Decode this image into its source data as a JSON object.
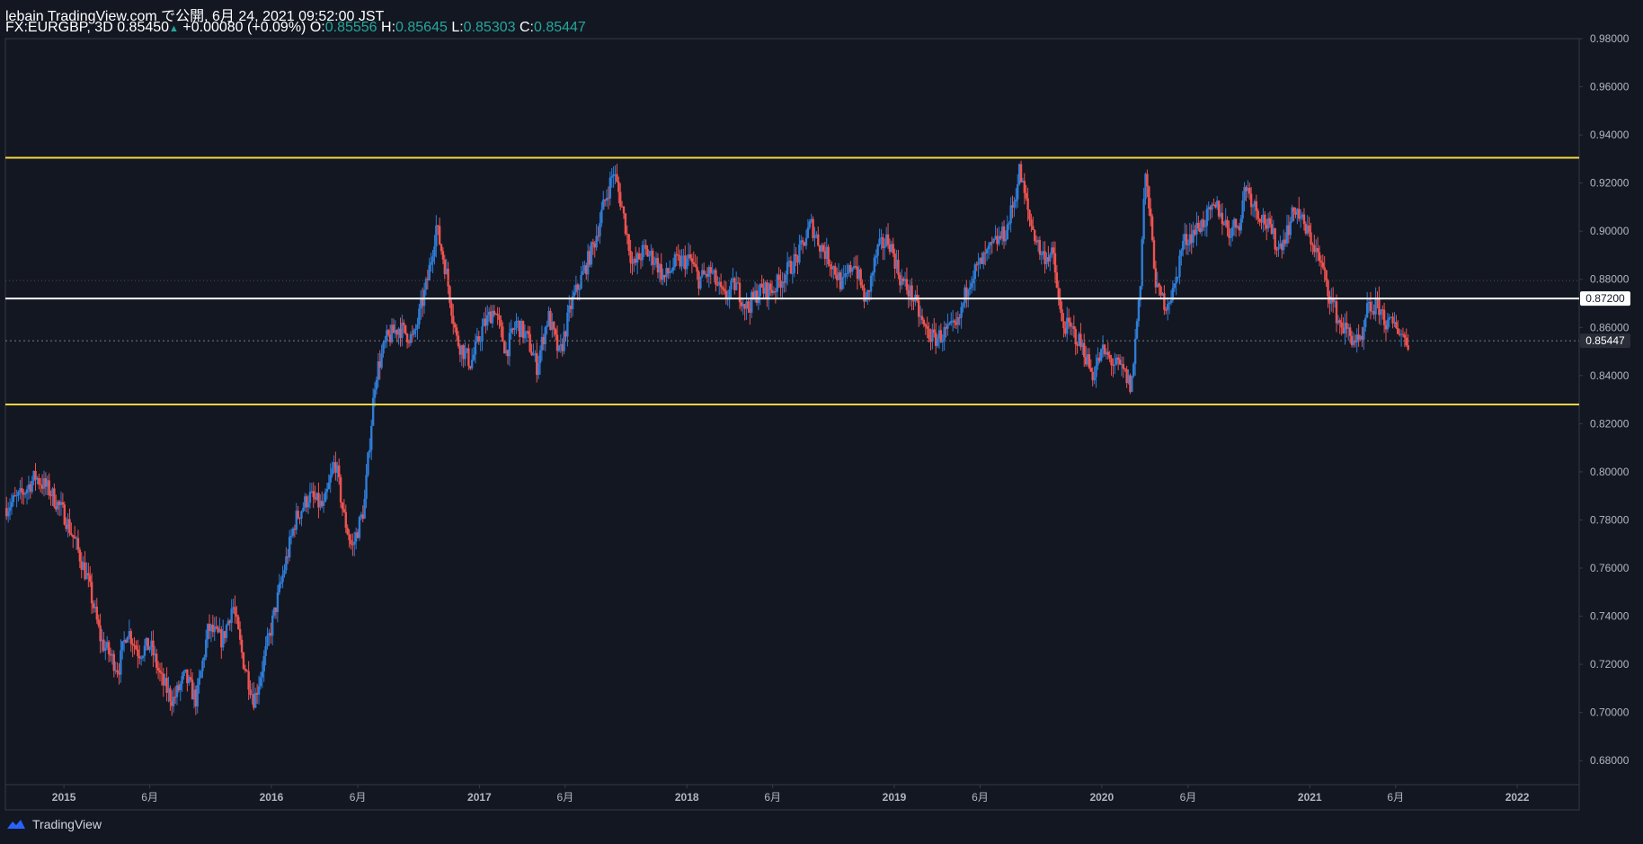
{
  "header": {
    "line1": "lebain TradingView.com で公開, 6月 24, 2021 09:52:00 JST",
    "symbol": "FX:EURGBP, 3D",
    "last": "0.85450",
    "arrow": "▲",
    "change": "+0.00080 (+0.09%)",
    "o_label": "O:",
    "o_value": "0.85556",
    "h_label": "H:",
    "h_value": "0.85645",
    "l_label": "L:",
    "l_value": "0.85303",
    "c_label": "C:",
    "c_value": "0.85447"
  },
  "footer": {
    "brand": "TradingView"
  },
  "colors": {
    "background": "#131722",
    "up": "#2e7dd7",
    "down": "#ef5350",
    "support_resistance": "#f5d547",
    "level_line": "#ffffff",
    "axis_text": "#b2b5be"
  },
  "chart_data": {
    "type": "candlestick",
    "title": "FX:EURGBP, 3D",
    "x_tick_labels": [
      "2015",
      "6月",
      "2016",
      "6月",
      "2017",
      "6月",
      "2018",
      "6月",
      "2019",
      "6月",
      "2020",
      "6月",
      "2021",
      "6月",
      "2022"
    ],
    "x_tick_dates": [
      "2015-01-01",
      "2015-06-01",
      "2016-01-01",
      "2016-06-01",
      "2017-01-01",
      "2017-06-01",
      "2018-01-01",
      "2018-06-01",
      "2019-01-01",
      "2019-06-01",
      "2020-01-01",
      "2020-06-01",
      "2021-01-01",
      "2021-06-01",
      "2022-01-01"
    ],
    "xlim": [
      "2014-09-20",
      "2022-04-20"
    ],
    "ylim": [
      0.67,
      0.98
    ],
    "y_tick_labels": [
      "0.98000",
      "0.96000",
      "0.94000",
      "0.92000",
      "0.90000",
      "0.88000",
      "0.86000",
      "0.84000",
      "0.82000",
      "0.80000",
      "0.78000",
      "0.76000",
      "0.74000",
      "0.72000",
      "0.70000",
      "0.68000"
    ],
    "y_ticks": [
      0.98,
      0.96,
      0.94,
      0.92,
      0.9,
      0.88,
      0.86,
      0.84,
      0.82,
      0.8,
      0.78,
      0.76,
      0.74,
      0.72,
      0.7,
      0.68
    ],
    "price_path": [
      [
        "2014-09-22",
        0.785
      ],
      [
        "2014-10-20",
        0.79
      ],
      [
        "2014-11-15",
        0.798
      ],
      [
        "2014-12-10",
        0.792
      ],
      [
        "2015-01-05",
        0.782
      ],
      [
        "2015-01-25",
        0.77
      ],
      [
        "2015-02-15",
        0.755
      ],
      [
        "2015-03-10",
        0.73
      ],
      [
        "2015-04-10",
        0.718
      ],
      [
        "2015-04-25",
        0.735
      ],
      [
        "2015-05-15",
        0.725
      ],
      [
        "2015-06-05",
        0.728
      ],
      [
        "2015-06-25",
        0.713
      ],
      [
        "2015-07-15",
        0.705
      ],
      [
        "2015-08-05",
        0.715
      ],
      [
        "2015-08-25",
        0.705
      ],
      [
        "2015-09-15",
        0.735
      ],
      [
        "2015-10-10",
        0.73
      ],
      [
        "2015-10-28",
        0.745
      ],
      [
        "2015-11-15",
        0.722
      ],
      [
        "2015-12-05",
        0.705
      ],
      [
        "2015-12-25",
        0.725
      ],
      [
        "2016-01-25",
        0.758
      ],
      [
        "2016-02-15",
        0.78
      ],
      [
        "2016-03-10",
        0.79
      ],
      [
        "2016-04-05",
        0.785
      ],
      [
        "2016-04-25",
        0.805
      ],
      [
        "2016-05-10",
        0.782
      ],
      [
        "2016-05-25",
        0.768
      ],
      [
        "2016-06-15",
        0.785
      ],
      [
        "2016-06-24",
        0.81
      ],
      [
        "2016-07-05",
        0.84
      ],
      [
        "2016-07-25",
        0.855
      ],
      [
        "2016-08-15",
        0.86
      ],
      [
        "2016-09-10",
        0.855
      ],
      [
        "2016-10-05",
        0.88
      ],
      [
        "2016-10-20",
        0.902
      ],
      [
        "2016-11-05",
        0.885
      ],
      [
        "2016-11-25",
        0.855
      ],
      [
        "2016-12-20",
        0.845
      ],
      [
        "2017-01-10",
        0.86
      ],
      [
        "2017-01-30",
        0.868
      ],
      [
        "2017-02-20",
        0.85
      ],
      [
        "2017-03-10",
        0.862
      ],
      [
        "2017-03-30",
        0.855
      ],
      [
        "2017-04-15",
        0.844
      ],
      [
        "2017-05-05",
        0.865
      ],
      [
        "2017-05-25",
        0.848
      ],
      [
        "2017-06-15",
        0.87
      ],
      [
        "2017-07-05",
        0.882
      ],
      [
        "2017-07-25",
        0.895
      ],
      [
        "2017-08-10",
        0.91
      ],
      [
        "2017-08-28",
        0.925
      ],
      [
        "2017-09-12",
        0.91
      ],
      [
        "2017-10-01",
        0.885
      ],
      [
        "2017-10-20",
        0.892
      ],
      [
        "2017-11-10",
        0.888
      ],
      [
        "2017-11-25",
        0.88
      ],
      [
        "2017-12-15",
        0.887
      ],
      [
        "2018-01-10",
        0.888
      ],
      [
        "2018-01-25",
        0.88
      ],
      [
        "2018-02-15",
        0.883
      ],
      [
        "2018-03-10",
        0.872
      ],
      [
        "2018-03-30",
        0.878
      ],
      [
        "2018-04-20",
        0.868
      ],
      [
        "2018-05-10",
        0.875
      ],
      [
        "2018-06-05",
        0.876
      ],
      [
        "2018-06-25",
        0.882
      ],
      [
        "2018-07-20",
        0.89
      ],
      [
        "2018-08-10",
        0.903
      ],
      [
        "2018-08-25",
        0.895
      ],
      [
        "2018-09-15",
        0.887
      ],
      [
        "2018-10-05",
        0.877
      ],
      [
        "2018-10-25",
        0.888
      ],
      [
        "2018-11-15",
        0.87
      ],
      [
        "2018-12-05",
        0.892
      ],
      [
        "2018-12-25",
        0.897
      ],
      [
        "2019-01-15",
        0.88
      ],
      [
        "2019-02-05",
        0.873
      ],
      [
        "2019-02-25",
        0.86
      ],
      [
        "2019-03-15",
        0.855
      ],
      [
        "2019-04-05",
        0.858
      ],
      [
        "2019-04-25",
        0.86
      ],
      [
        "2019-05-15",
        0.88
      ],
      [
        "2019-06-10",
        0.888
      ],
      [
        "2019-06-30",
        0.895
      ],
      [
        "2019-07-20",
        0.9
      ],
      [
        "2019-08-05",
        0.915
      ],
      [
        "2019-08-12",
        0.925
      ],
      [
        "2019-08-30",
        0.905
      ],
      [
        "2019-09-20",
        0.89
      ],
      [
        "2019-10-10",
        0.89
      ],
      [
        "2019-10-25",
        0.862
      ],
      [
        "2019-11-15",
        0.858
      ],
      [
        "2019-12-05",
        0.85
      ],
      [
        "2019-12-18",
        0.84
      ],
      [
        "2020-01-05",
        0.85
      ],
      [
        "2020-01-25",
        0.845
      ],
      [
        "2020-02-10",
        0.842
      ],
      [
        "2020-02-25",
        0.835
      ],
      [
        "2020-03-05",
        0.86
      ],
      [
        "2020-03-12",
        0.88
      ],
      [
        "2020-03-20",
        0.925
      ],
      [
        "2020-03-27",
        0.91
      ],
      [
        "2020-04-10",
        0.875
      ],
      [
        "2020-04-25",
        0.87
      ],
      [
        "2020-05-10",
        0.875
      ],
      [
        "2020-05-25",
        0.895
      ],
      [
        "2020-06-15",
        0.9
      ],
      [
        "2020-07-05",
        0.905
      ],
      [
        "2020-07-25",
        0.91
      ],
      [
        "2020-08-15",
        0.9
      ],
      [
        "2020-09-05",
        0.905
      ],
      [
        "2020-09-12",
        0.92
      ],
      [
        "2020-09-30",
        0.91
      ],
      [
        "2020-10-20",
        0.903
      ],
      [
        "2020-11-10",
        0.893
      ],
      [
        "2020-11-25",
        0.9
      ],
      [
        "2020-12-10",
        0.91
      ],
      [
        "2020-12-25",
        0.902
      ],
      [
        "2021-01-10",
        0.895
      ],
      [
        "2021-01-25",
        0.885
      ],
      [
        "2021-02-10",
        0.872
      ],
      [
        "2021-02-25",
        0.862
      ],
      [
        "2021-03-15",
        0.857
      ],
      [
        "2021-04-05",
        0.852
      ],
      [
        "2021-04-15",
        0.867
      ],
      [
        "2021-05-05",
        0.869
      ],
      [
        "2021-05-20",
        0.861
      ],
      [
        "2021-06-05",
        0.861
      ],
      [
        "2021-06-15",
        0.857
      ],
      [
        "2021-06-24",
        0.8545
      ]
    ],
    "horizontal_lines": [
      {
        "role": "resistance",
        "y": 0.9305,
        "color": "#f5d547"
      },
      {
        "role": "support",
        "y": 0.828,
        "color": "#f5d547"
      },
      {
        "role": "level",
        "y": 0.872,
        "color": "#ffffff",
        "label": "0.87200"
      },
      {
        "role": "last-price",
        "y": 0.85447,
        "color": "#787b86",
        "label": "0.85447"
      }
    ]
  }
}
